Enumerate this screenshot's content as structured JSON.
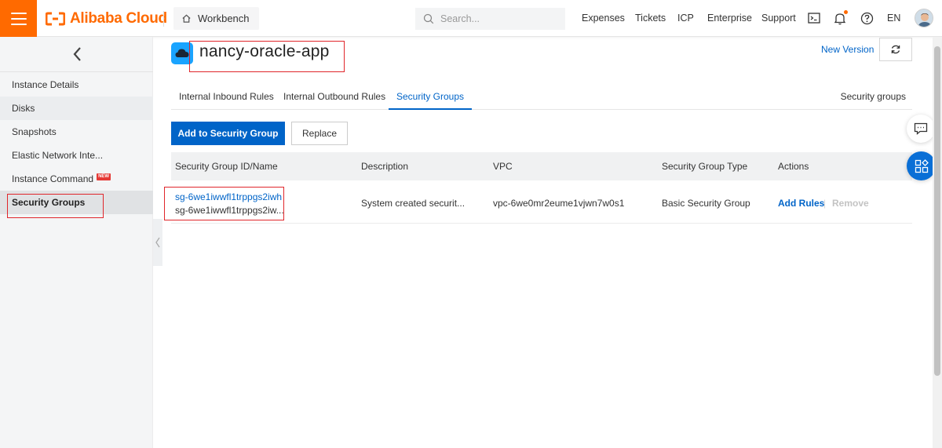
{
  "header": {
    "brand": "Alibaba Cloud",
    "workbench_label": "Workbench",
    "search_placeholder": "Search...",
    "nav": [
      "Expenses",
      "Tickets",
      "ICP",
      "Enterprise",
      "Support"
    ],
    "language": "EN",
    "icons": [
      "menu-icon",
      "terminal-icon",
      "bell-icon",
      "help-icon"
    ],
    "brand_color": "#ff6a00"
  },
  "sidebar": {
    "items": [
      {
        "label": "Instance Details"
      },
      {
        "label": "Disks"
      },
      {
        "label": "Snapshots"
      },
      {
        "label": "Elastic Network Inte..."
      },
      {
        "label": "Instance Command",
        "badge": "NEW"
      },
      {
        "label": "Security Groups",
        "active": true
      }
    ]
  },
  "instance": {
    "name": "nancy-oracle-app",
    "new_version": "New Version"
  },
  "tabs": {
    "items": [
      "Internal Inbound Rules",
      "Internal Outbound Rules",
      "Security Groups"
    ],
    "active": "Security Groups",
    "right_label": "Security groups"
  },
  "toolbar": {
    "add_label": "Add to Security Group",
    "replace_label": "Replace"
  },
  "table": {
    "columns": [
      "Security Group ID/Name",
      "Description",
      "VPC",
      "Security Group Type",
      "Actions"
    ],
    "rows": [
      {
        "id": "sg-6we1iwwfl1trppgs2iwh",
        "name": "sg-6we1iwwfl1trppgs2iw...",
        "description": "System created securit...",
        "vpc": "vpc-6we0mr2eume1vjwn7w0s1",
        "type": "Basic Security Group",
        "action_primary": "Add Rules",
        "action_separator": "|",
        "action_disabled": "Remove"
      }
    ]
  },
  "colors": {
    "primary": "#0064c8",
    "highlight_box": "#e0262b"
  }
}
